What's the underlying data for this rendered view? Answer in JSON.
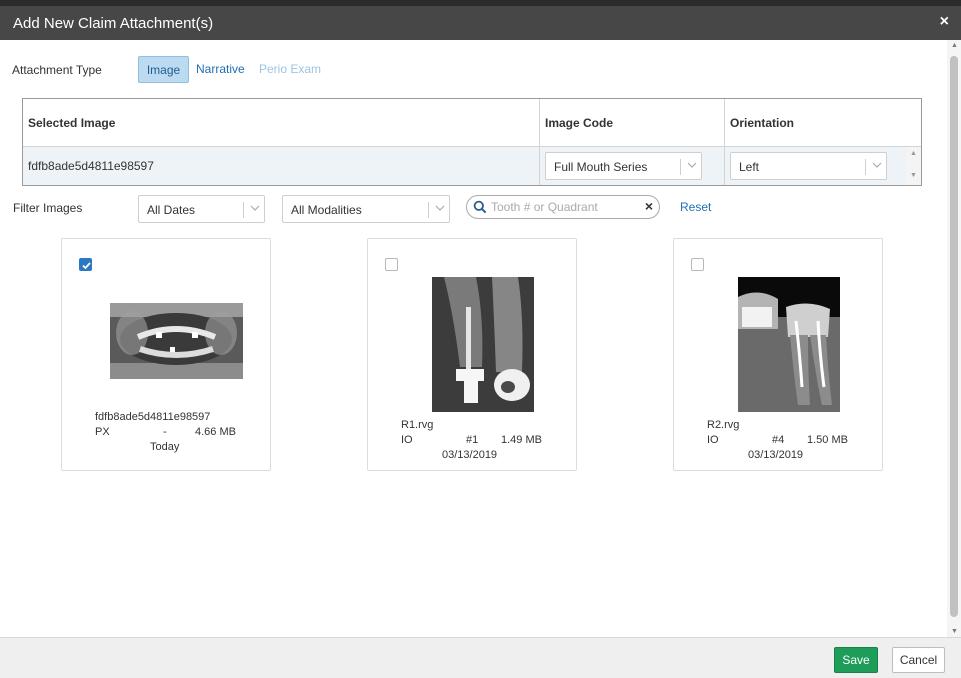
{
  "dialog": {
    "title": "Add New Claim Attachment(s)",
    "close_label": "×"
  },
  "attachment_type": {
    "label": "Attachment Type",
    "options": [
      "Image",
      "Narrative",
      "Perio Exam"
    ],
    "selected": "Image"
  },
  "grid": {
    "headers": [
      "Selected Image",
      "Image Code",
      "Orientation"
    ],
    "row": {
      "selected_image": "fdfb8ade5d4811e98597",
      "image_code": "Full Mouth Series",
      "orientation": "Left"
    }
  },
  "filters": {
    "label": "Filter Images",
    "dates": "All Dates",
    "modalities": "All Modalities",
    "search_placeholder": "Tooth # or Quadrant",
    "clear_label": "×",
    "reset_label": "Reset"
  },
  "images": [
    {
      "name": "fdfb8ade5d4811e98597",
      "modality": "PX",
      "tooth": "-",
      "size": "4.66 MB",
      "date": "Today",
      "checked": true
    },
    {
      "name": "R1.rvg",
      "modality": "IO",
      "tooth": "#1",
      "size": "1.49 MB",
      "date": "03/13/2019",
      "checked": false
    },
    {
      "name": "R2.rvg",
      "modality": "IO",
      "tooth": "#4",
      "size": "1.50 MB",
      "date": "03/13/2019",
      "checked": false
    }
  ],
  "footer": {
    "save_label": "Save",
    "cancel_label": "Cancel"
  },
  "colors": {
    "titlebar": "#474747",
    "primary": "#1e9c5a",
    "link": "#1f6fb5",
    "checkbox_checked": "#2b79c2",
    "selected_tab": "#bcdaf0"
  }
}
